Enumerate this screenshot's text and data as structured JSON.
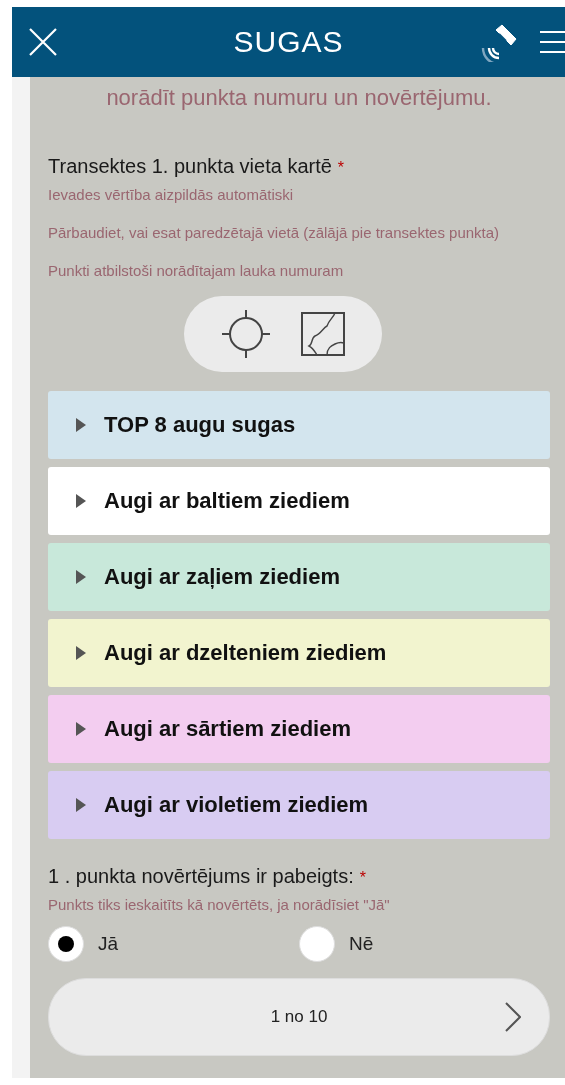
{
  "header": {
    "title": "SUGAS"
  },
  "intro_fragment": "norādīt punkta numuru un novērtējumu.",
  "location": {
    "label": "Transektes 1. punkta vieta kartē",
    "required_mark": "*",
    "hints": [
      "Ievades vērtība aizpildās automātiski",
      "Pārbaudiet, vai esat paredzētajā vietā (zālājā pie transektes punkta)",
      "Punkti atbilstoši norādītajam lauka numuram"
    ]
  },
  "groups": [
    {
      "label": "TOP 8 augu sugas",
      "color": "#d3e5ee",
      "expanded": false
    },
    {
      "label": "Augi ar baltiem ziediem",
      "color": "#ffffff",
      "expanded": false
    },
    {
      "label": "Augi ar zaļiem ziediem",
      "color": "#c8e8da",
      "expanded": false
    },
    {
      "label": "Augi ar dzelteniem ziediem",
      "color": "#f2f4cf",
      "expanded": false
    },
    {
      "label": "Augi ar sārtiem ziediem",
      "color": "#f3cdf0",
      "expanded": false
    },
    {
      "label": "Augi ar violetiem ziediem",
      "color": "#d8ccf2",
      "expanded": false
    }
  ],
  "completion": {
    "label": "1 . punkta novērtējums ir pabeigts:",
    "required_mark": "*",
    "hint": "Punkts tiks ieskaitīts kā novērtēts, ja norādīsiet \"Jā\"",
    "options": [
      {
        "label": "Jā",
        "selected": true
      },
      {
        "label": "Nē",
        "selected": false
      }
    ]
  },
  "pager": {
    "text": "1 no 10"
  }
}
